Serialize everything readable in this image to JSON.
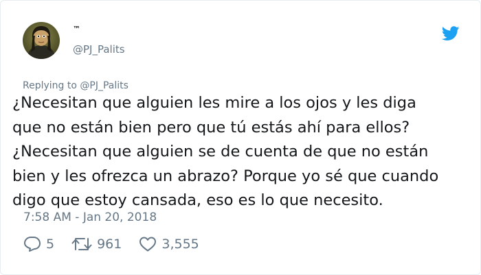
{
  "user": {
    "display_name": "™",
    "handle": "@PJ_Palits"
  },
  "tweet": {
    "replying_to": "Replying to @PJ_Palits",
    "lines": [
      "¿Necesitan que alguien les mire a los ojos y les diga",
      "que no están bien pero que tú estás ahí para ellos?",
      "¿Necesitan que alguien se de cuenta de que no están",
      "bien y les ofrezca un abrazo? Porque yo sé que cuando",
      "digo que estoy cansada, eso es lo que necesito."
    ],
    "timestamp": "7:58 AM - Jan 20, 2018"
  },
  "stats": {
    "replies": "5",
    "retweets": "961",
    "likes": "3,555"
  },
  "icons": {
    "brand": "twitter-bird-icon",
    "reply": "reply-icon",
    "retweet": "retweet-icon",
    "like": "heart-icon"
  },
  "colors": {
    "brand": "#1da1f2",
    "text": "#14171a",
    "muted": "#657786"
  }
}
